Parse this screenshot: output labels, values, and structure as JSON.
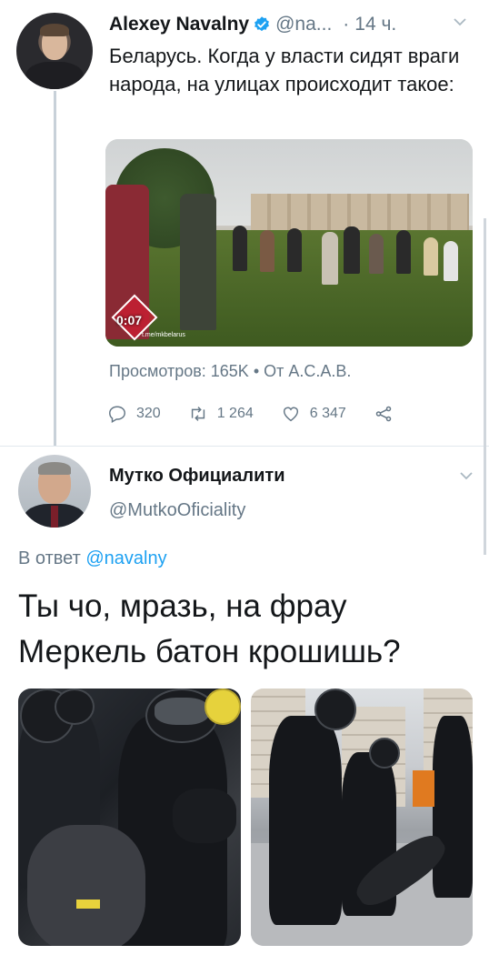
{
  "tweet1": {
    "author_name": "Alexey Navalny",
    "handle": "@na...",
    "separator": "·",
    "time": "14 ч.",
    "text": "Беларусь. Когда у власти сидят враги народа, на улицах происходит такое:",
    "video": {
      "duration": "0:07",
      "watermark": "t.me/mkbelarus"
    },
    "views": "Просмотров: 165K • От А.С.А.В.",
    "actions": {
      "replies": "320",
      "retweets": "1 264",
      "likes": "6 347"
    }
  },
  "tweet2": {
    "author_name": "Мутко Официалити",
    "handle": "@MutkoOficiality",
    "reply_prefix": "В ответ",
    "reply_mention": "@navalny",
    "text": "Ты чо, мразь, на фрау Меркель батон крошишь?"
  },
  "colors": {
    "accent": "#1da1f2",
    "secondary_text": "#657786",
    "primary_text": "#14171a",
    "verified": "#1da1f2"
  },
  "icons": {
    "verified": "verified-badge-icon",
    "chevron": "chevron-down-icon",
    "reply": "reply-icon",
    "retweet": "retweet-icon",
    "like": "heart-icon",
    "share": "share-icon"
  }
}
